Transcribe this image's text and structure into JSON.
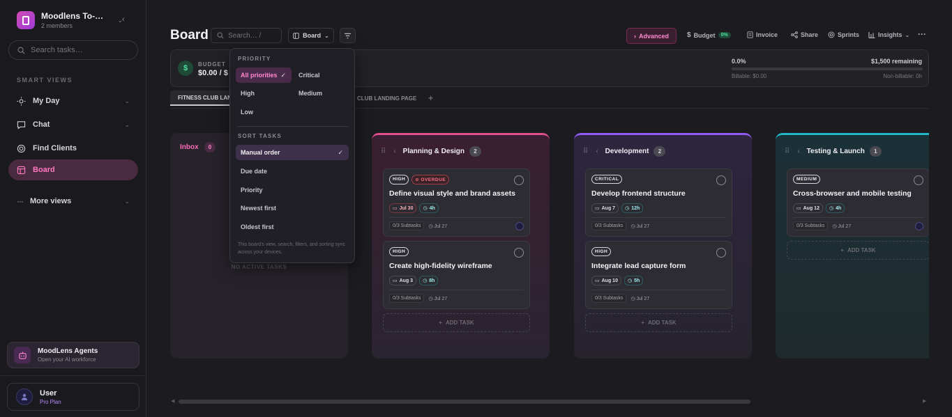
{
  "workspace": {
    "name": "Moodlens To-…",
    "members": "2 members"
  },
  "sidebar": {
    "search_placeholder": "Search tasks…",
    "section_label": "SMART VIEWS",
    "items": [
      {
        "label": "My Day"
      },
      {
        "label": "Chat"
      },
      {
        "label": "Find Clients"
      },
      {
        "label": "Board"
      },
      {
        "label": "More views"
      }
    ],
    "agents": {
      "title": "MoodLens Agents",
      "subtitle": "Open your AI workforce"
    },
    "user": {
      "name": "User",
      "plan": "Pro Plan"
    }
  },
  "header": {
    "title": "Board",
    "search_placeholder": "Search… /",
    "view_label": "Board",
    "advanced": "Advanced",
    "budget": "Budget",
    "budget_pct": "0%",
    "invoice": "Invoice",
    "share": "Share",
    "sprints": "Sprints",
    "insights": "Insights"
  },
  "budget": {
    "label": "BUDGET",
    "value": "$0.00 / $",
    "progress_pct": "0.0%",
    "remaining": "$1,500 remaining",
    "billable": "Billable: $0.00",
    "nonbillable": "Non-billable: 0h"
  },
  "tabs": {
    "active": "FITNESS CLUB LANDING PAGE",
    "second": "CLUB LANDING PAGE"
  },
  "dropdown": {
    "priority_label": "PRIORITY",
    "priority_options": [
      "All priorities",
      "Critical",
      "High",
      "Medium",
      "Low"
    ],
    "sort_label": "SORT TASKS",
    "sort_options": [
      "Manual order",
      "Due date",
      "Priority",
      "Newest first",
      "Oldest first"
    ],
    "note": "This board's view, search, filters, and sorting sync across your devices."
  },
  "columns": {
    "inbox": {
      "title": "Inbox",
      "count": "0",
      "empty": "NO ACTIVE TASKS"
    },
    "plan": {
      "title": "Planning & Design",
      "count": "2"
    },
    "dev": {
      "title": "Development",
      "count": "2"
    },
    "test": {
      "title": "Testing & Launch",
      "count": "1"
    },
    "add_task": "ADD TASK"
  },
  "cards": {
    "c1": {
      "priority": "HIGH",
      "overdue": "OVERDUE",
      "title": "Define visual style and brand assets",
      "due": "Jul 30",
      "est": "4h",
      "subtasks": "0/3 Subtasks",
      "created": "Jul 27"
    },
    "c2": {
      "priority": "HIGH",
      "title": "Create high-fidelity wireframe",
      "due": "Aug 3",
      "est": "8h",
      "subtasks": "0/3 Subtasks",
      "created": "Jul 27"
    },
    "c3": {
      "priority": "CRITICAL",
      "title": "Develop frontend structure",
      "due": "Aug 7",
      "est": "12h",
      "subtasks": "0/3 Subtasks",
      "created": "Jul 27"
    },
    "c4": {
      "priority": "HIGH",
      "title": "Integrate lead capture form",
      "due": "Aug 10",
      "est": "5h",
      "subtasks": "0/3 Subtasks",
      "created": "Jul 27"
    },
    "c5": {
      "priority": "MEDIUM",
      "title": "Cross-browser and mobile testing",
      "due": "Aug 12",
      "est": "4h",
      "subtasks": "0/3 Subtasks",
      "created": "Jul 27"
    }
  }
}
